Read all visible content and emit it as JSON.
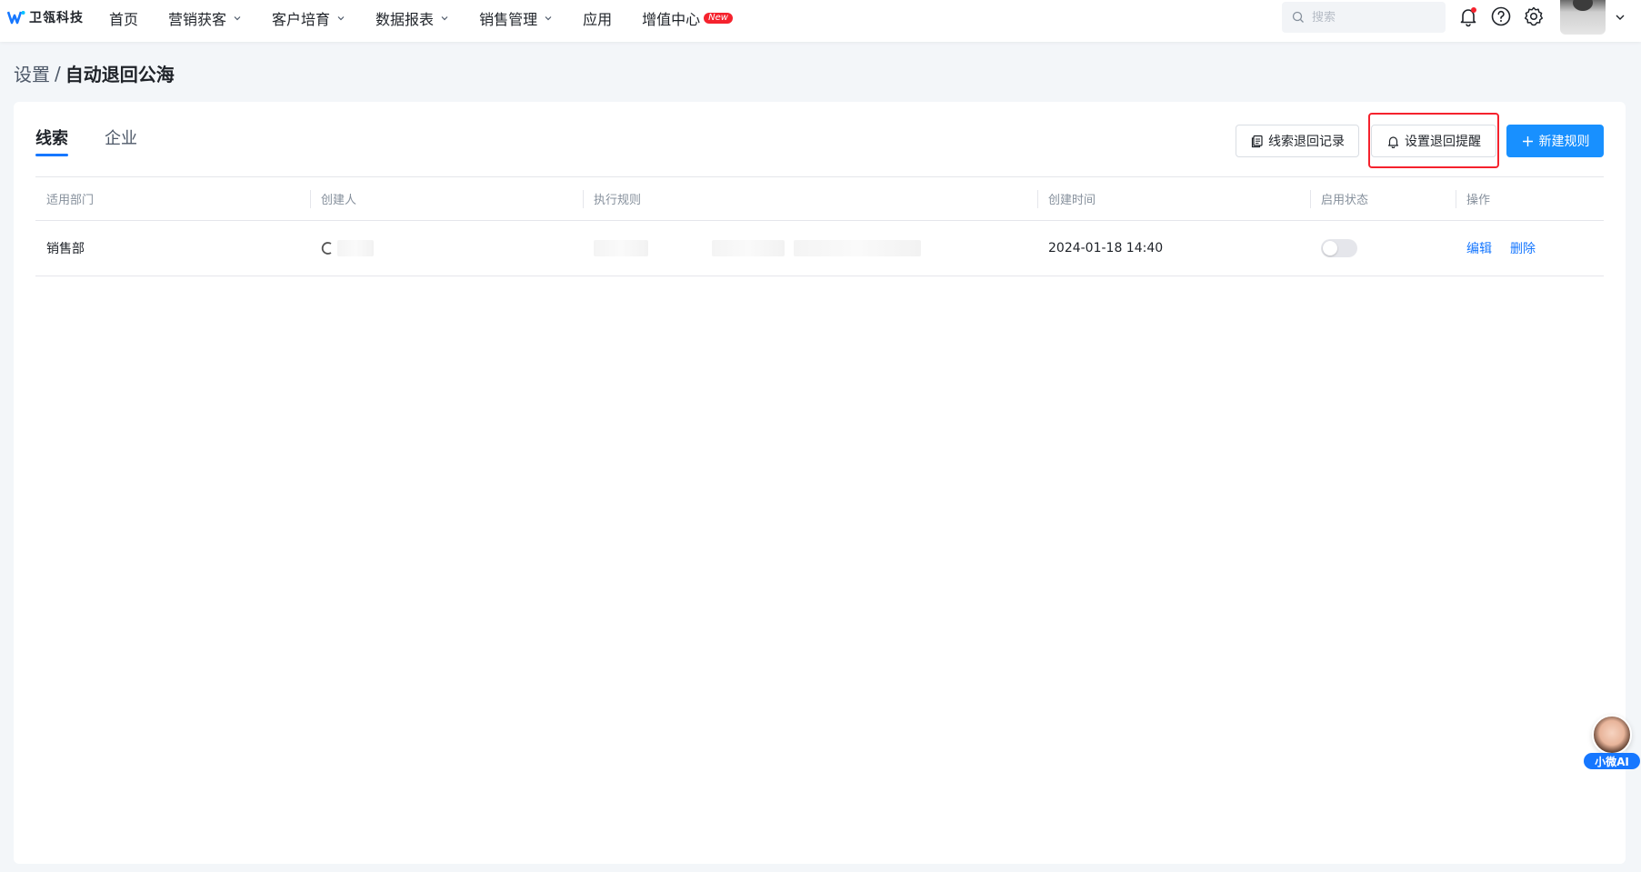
{
  "brand": {
    "name": "卫瓴科技"
  },
  "nav": [
    {
      "label": "首页",
      "dropdown": false
    },
    {
      "label": "营销获客",
      "dropdown": true
    },
    {
      "label": "客户培育",
      "dropdown": true
    },
    {
      "label": "数据报表",
      "dropdown": true
    },
    {
      "label": "销售管理",
      "dropdown": true
    },
    {
      "label": "应用",
      "dropdown": false
    },
    {
      "label": "增值中心",
      "dropdown": false,
      "badge": "New"
    }
  ],
  "search": {
    "placeholder": "搜索"
  },
  "breadcrumb": {
    "parent": "设置",
    "separator": "/",
    "current": "自动退回公海"
  },
  "tabs": [
    {
      "label": "线索",
      "active": true
    },
    {
      "label": "企业",
      "active": false
    }
  ],
  "actions": {
    "records": "线索退回记录",
    "reminder": "设置退回提醒",
    "new_rule": "新建规则"
  },
  "table": {
    "columns": [
      "适用部门",
      "创建人",
      "执行规则",
      "创建时间",
      "启用状态",
      "操作"
    ],
    "rows": [
      {
        "department": "销售部",
        "created_at": "2024-01-18 14:40",
        "enabled": false,
        "edit": "编辑",
        "delete": "删除"
      }
    ]
  },
  "assistant": {
    "label": "小微AI"
  },
  "colors": {
    "primary": "#1890ff",
    "highlight": "#f5222d",
    "badge": "#f5222d"
  }
}
